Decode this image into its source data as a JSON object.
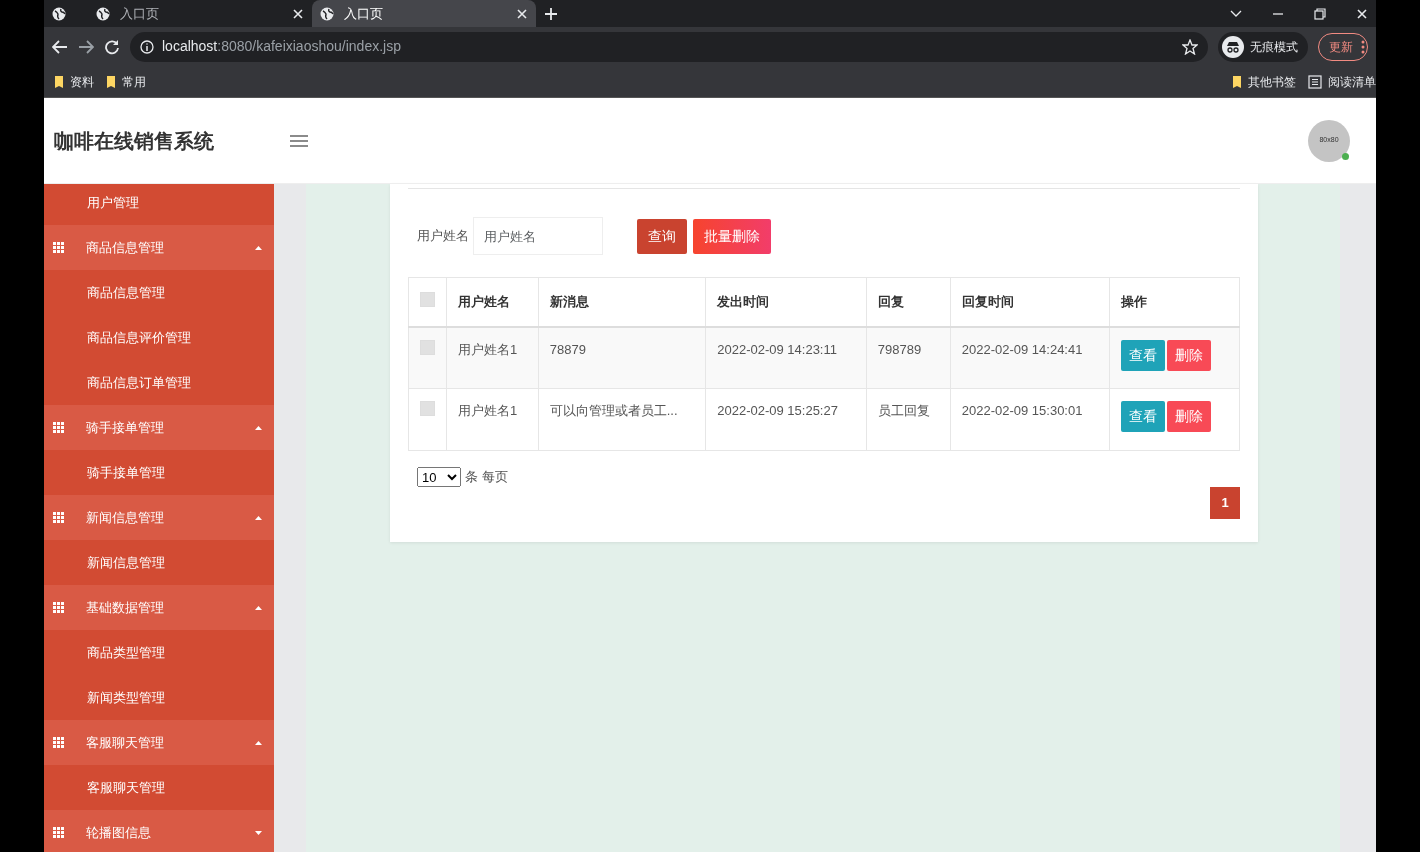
{
  "browser": {
    "tabs": [
      {
        "title": "入口页",
        "selected": false
      },
      {
        "title": "入口页",
        "selected": true
      }
    ],
    "address": {
      "host": "localhost",
      "path": ":8080/kafeixiaoshou/index.jsp"
    },
    "incognito_label": "无痕模式",
    "update_button": "更新",
    "bookmarks": [
      "资料",
      "常用"
    ],
    "other_bookmarks": "其他书签",
    "reading_list": "阅读清单"
  },
  "header": {
    "title": "咖啡在线销售系统",
    "avatar_text": "80x80",
    "online": true
  },
  "sidebar": {
    "items": [
      {
        "kind": "link",
        "label": "用户管理"
      },
      {
        "kind": "group",
        "label": "商品信息管理",
        "expanded": true,
        "children": [
          {
            "label": "商品信息管理"
          },
          {
            "label": "商品信息评价管理"
          },
          {
            "label": "商品信息订单管理"
          }
        ]
      },
      {
        "kind": "group",
        "label": "骑手接单管理",
        "expanded": true,
        "children": [
          {
            "label": "骑手接单管理"
          }
        ]
      },
      {
        "kind": "group",
        "label": "新闻信息管理",
        "expanded": true,
        "children": [
          {
            "label": "新闻信息管理"
          }
        ]
      },
      {
        "kind": "group",
        "label": "基础数据管理",
        "expanded": true,
        "children": [
          {
            "label": "商品类型管理"
          },
          {
            "label": "新闻类型管理"
          }
        ]
      },
      {
        "kind": "group",
        "label": "客服聊天管理",
        "expanded": true,
        "children": [
          {
            "label": "客服聊天管理"
          }
        ]
      },
      {
        "kind": "group",
        "label": "轮播图信息",
        "expanded": false
      }
    ]
  },
  "search": {
    "label": "用户姓名",
    "placeholder": "用户姓名",
    "buttons": [
      {
        "kind": "query",
        "label": "查询"
      },
      {
        "kind": "batch-delete",
        "label": "批量删除"
      }
    ]
  },
  "table": {
    "select_all_checked": false,
    "columns": [
      "用户姓名",
      "新消息",
      "发出时间",
      "回复",
      "回复时间",
      "操作"
    ],
    "rows": [
      {
        "checked": false,
        "cells": [
          "用户姓名1",
          "78879",
          "2022-02-09 14:23:11",
          "798789",
          "2022-02-09 14:24:41"
        ],
        "actions": [
          "查看",
          "删除"
        ]
      },
      {
        "checked": false,
        "cells": [
          "用户姓名1",
          "可以向管理或者员工...",
          "2022-02-09 15:25:27",
          "员工回复",
          "2022-02-09 15:30:01"
        ],
        "actions": [
          "查看",
          "删除"
        ]
      }
    ]
  },
  "pagination": {
    "per_page": "10",
    "per_page_label": "条 每页",
    "pages": [
      {
        "label": "1",
        "selected": true
      }
    ]
  }
}
